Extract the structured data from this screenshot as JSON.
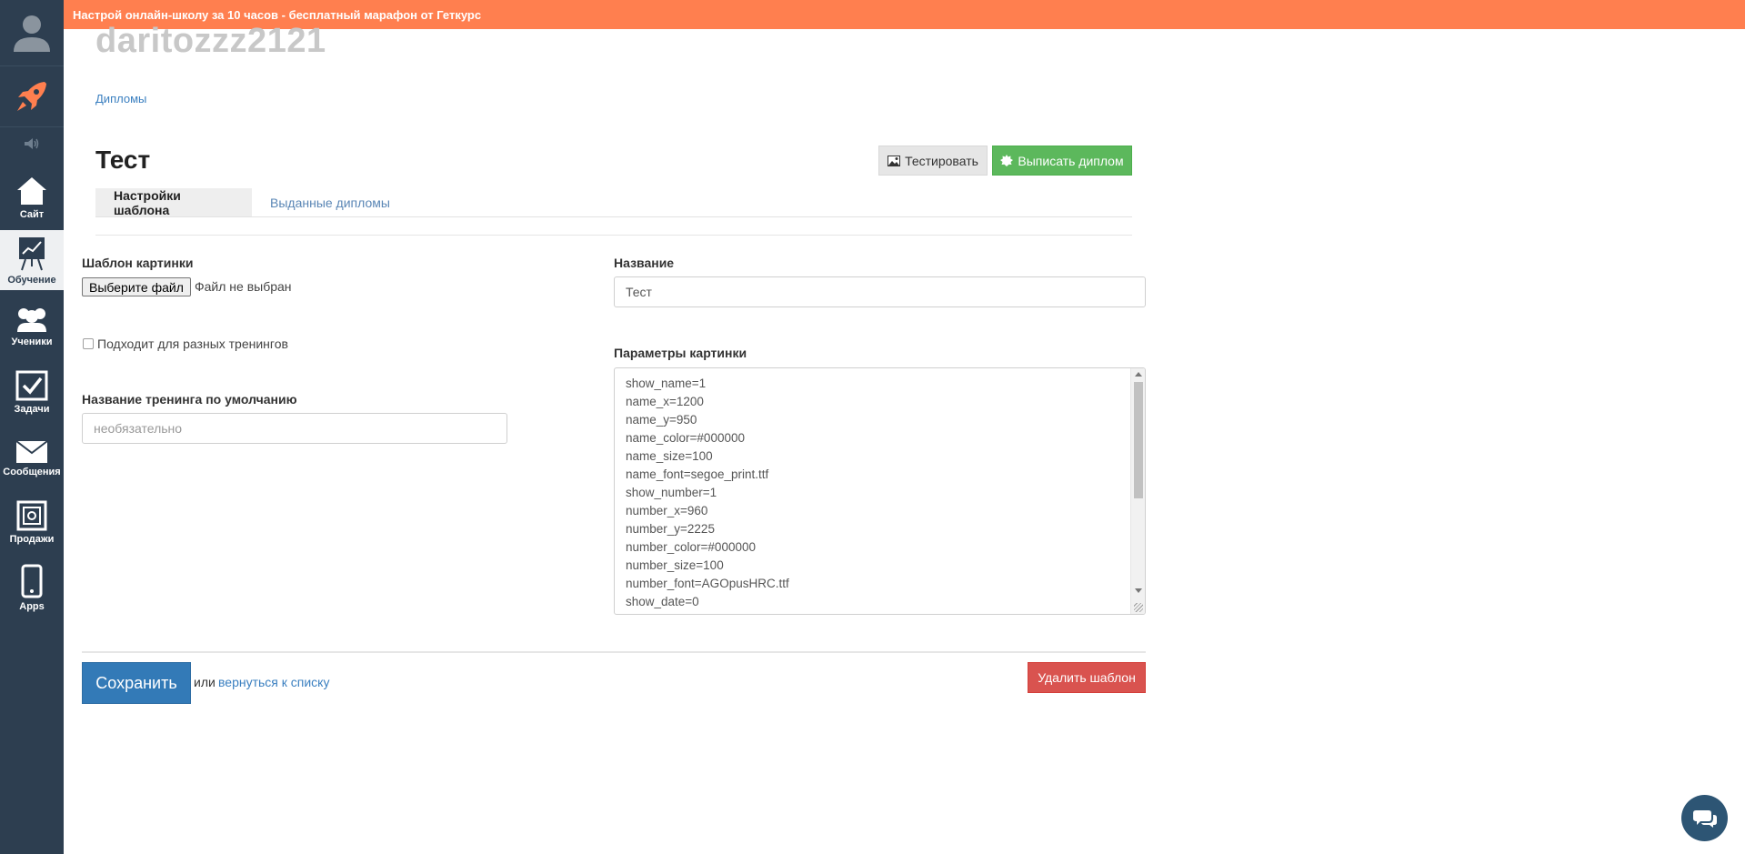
{
  "banner": {
    "text": "Настрой онлайн-школу за 10 часов - бесплатный марафон от Геткурс"
  },
  "sidebar": {
    "items": [
      {
        "label": "Сайт"
      },
      {
        "label": "Обучение"
      },
      {
        "label": "Ученики"
      },
      {
        "label": "Задачи"
      },
      {
        "label": "Сообщения"
      },
      {
        "label": "Продажи"
      },
      {
        "label": "Apps"
      }
    ]
  },
  "header": {
    "user_title": "daritozzz2121",
    "breadcrumb": "Дипломы",
    "page_title": "Тест",
    "test_button": "Тестировать",
    "issue_button": "Выписать диплом"
  },
  "tabs": [
    {
      "label": "Настройки шаблона"
    },
    {
      "label": "Выданные дипломы"
    }
  ],
  "form": {
    "image_template_label": "Шаблон картинки",
    "file_button": "Выберите файл",
    "file_status": "Файл не выбран",
    "multi_training_label": "Подходит для разных тренингов",
    "default_training_label": "Название тренинга по умолчанию",
    "default_training_placeholder": "необязательно",
    "name_label": "Название",
    "name_value": "Тест",
    "params_label": "Параметры картинки",
    "params_lines": [
      "show_name=1",
      "name_x=1200",
      "name_y=950",
      "name_color=#000000",
      "name_size=100",
      "name_font=segoe_print.ttf",
      "show_number=1",
      "number_x=960",
      "number_y=2225",
      "number_color=#000000",
      "number_size=100",
      "number_font=AGOpusHRC.ttf",
      "show_date=0"
    ]
  },
  "footer": {
    "save_button": "Сохранить",
    "or_text": "или",
    "back_link": "вернуться к списку",
    "delete_button": "Удалить шаблон"
  },
  "colors": {
    "banner": "#ff7f4f",
    "sidebar": "#2d3e50",
    "primary": "#337ab7",
    "success": "#5cb85c",
    "danger": "#d9534f"
  }
}
